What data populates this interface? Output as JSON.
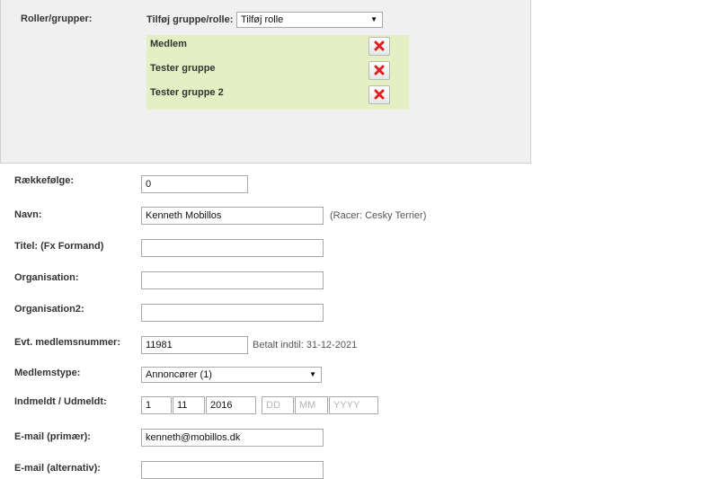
{
  "roles": {
    "label": "Roller/grupper:",
    "add_label": "Tilføj gruppe/rolle:",
    "add_select_value": "Tilføj rolle",
    "groups": [
      "Medlem",
      "Tester gruppe",
      "Tester gruppe 2"
    ]
  },
  "form": {
    "raekkefoelge": {
      "label": "Rækkefølge:",
      "value": "0"
    },
    "navn": {
      "label": "Navn:",
      "value": "Kenneth Mobillos",
      "note": "(Racer: Cesky Terrier)"
    },
    "titel": {
      "label": "Titel: (Fx Formand)",
      "value": ""
    },
    "organisation": {
      "label": "Organisation:",
      "value": ""
    },
    "organisation2": {
      "label": "Organisation2:",
      "value": ""
    },
    "medlemsnummer": {
      "label": "Evt. medlemsnummer:",
      "value": "11981",
      "note": "Betalt indtil: 31-12-2021"
    },
    "medlemstype": {
      "label": "Medlemstype:",
      "value": "Annoncører (1)"
    },
    "indmeldt": {
      "label": "Indmeldt / Udmeldt:",
      "in_day": "1",
      "in_month": "11",
      "in_year": "2016",
      "out_day_placeholder": "DD",
      "out_month_placeholder": "MM",
      "out_year_placeholder": "YYYY"
    },
    "email_primary": {
      "label": "E-mail (primær):",
      "value": "kenneth@mobillos.dk"
    },
    "email_alt": {
      "label": "E-mail (alternativ):",
      "value": ""
    }
  },
  "colors": {
    "panel_bg": "#f0f0f0",
    "group_bg": "#e4efc4",
    "delete_icon": "#e02020"
  },
  "icons": {
    "delete": "x-icon"
  }
}
